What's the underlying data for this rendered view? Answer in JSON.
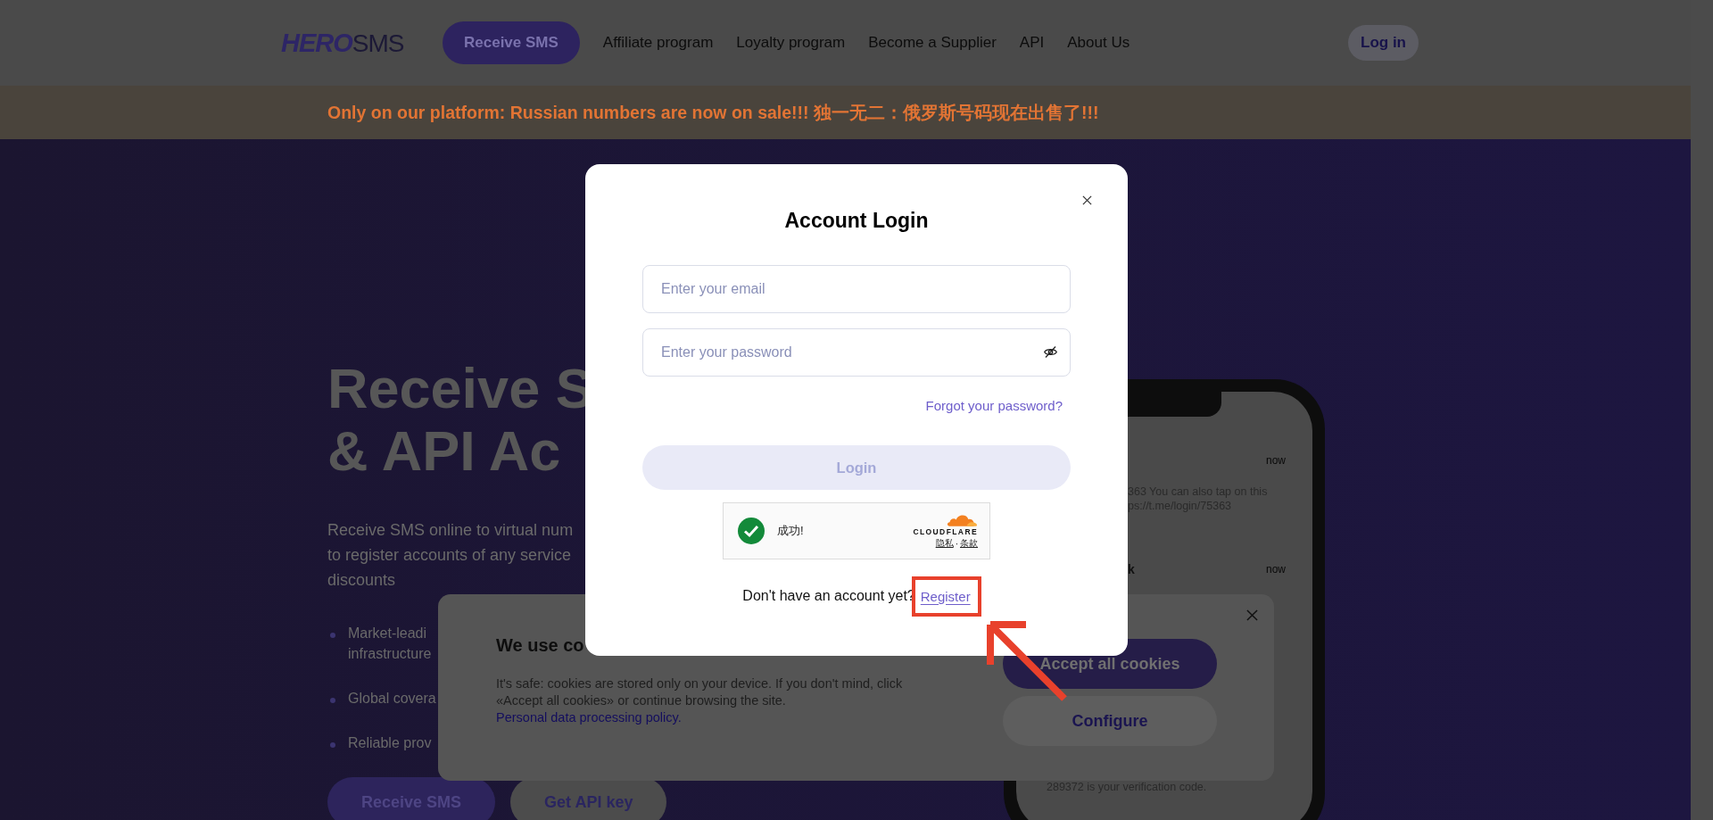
{
  "header": {
    "logo": {
      "bold_part": "HERO",
      "light_part": "SMS"
    },
    "nav": [
      {
        "label": "Receive SMS",
        "kind": "button"
      },
      {
        "label": "Affiliate program",
        "kind": "link"
      },
      {
        "label": "Loyalty program",
        "kind": "link"
      },
      {
        "label": "Become a Supplier",
        "kind": "link"
      },
      {
        "label": "API",
        "kind": "link"
      },
      {
        "label": "About Us",
        "kind": "link"
      }
    ],
    "login_button": "Log in"
  },
  "banner": {
    "text": "Only on our platform: Russian numbers are now on sale!!! 独一无二：俄罗斯号码现在出售了!!!"
  },
  "hero": {
    "title_lines": [
      "Receive S",
      "& API Ac"
    ],
    "description_lines": [
      "Receive SMS online to virtual num",
      "to register accounts of any service",
      "discounts"
    ],
    "features": [
      {
        "lines": [
          "Market-leadi",
          "infrastructure"
        ]
      },
      {
        "lines": [
          "Global covera"
        ]
      },
      {
        "lines": [
          "Reliable prov"
        ]
      }
    ],
    "buttons": [
      {
        "label": "Receive SMS",
        "kind": "primary"
      },
      {
        "label": "Get API key",
        "kind": "secondary"
      }
    ]
  },
  "phone": {
    "notifications": [
      {
        "time": "now",
        "lines": [
          "363 You can also tap on this",
          "ps://t.me/login/75363"
        ]
      },
      {
        "time": "now",
        "title": "k"
      },
      {
        "lines": [
          "289372 is your verification code."
        ]
      }
    ]
  },
  "cookie_banner": {
    "title": "We use co",
    "text": "It's safe: cookies are stored only on your device. If you don't mind, click «Accept all cookies» or continue browsing the site.",
    "policy_link": "Personal data processing policy.",
    "buttons": [
      {
        "label": "Accept all cookies",
        "kind": "primary"
      },
      {
        "label": "Configure",
        "kind": "secondary"
      }
    ]
  },
  "login_modal": {
    "title": "Account Login",
    "email": {
      "placeholder": "Enter your email"
    },
    "password": {
      "placeholder": "Enter your password"
    },
    "forgot_link": "Forgot your password?",
    "login_button": {
      "label": "Login",
      "disabled": true
    },
    "captcha": {
      "status": "成功!",
      "verified": true,
      "brand": "CLOUDFLARE",
      "links": [
        "隐私",
        "条款"
      ],
      "separator": "·"
    },
    "register_prompt": "Don't have an account yet?",
    "register_link": "Register"
  }
}
